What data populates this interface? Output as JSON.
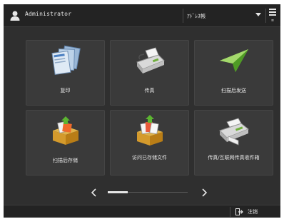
{
  "header": {
    "user_name": "Administrator",
    "user_icon": "user-icon",
    "dropdown_value": "ｱﾄﾞﾚｽ帳",
    "menu_icon": "menu-icon",
    "menu_sub": "≡"
  },
  "tiles": [
    {
      "label": "复印",
      "icon": "copy-icon"
    },
    {
      "label": "传真",
      "icon": "fax-icon"
    },
    {
      "label": "扫描后发送",
      "icon": "scan-send-icon"
    },
    {
      "label": "扫描后存储",
      "icon": "scan-store-icon"
    },
    {
      "label": "访问已存储文件",
      "icon": "stored-files-icon"
    },
    {
      "label": "传真/互联网传真收件箱",
      "icon": "fax-inbox-icon"
    }
  ],
  "pager": {
    "prev_icon": "chevron-left-icon",
    "next_icon": "chevron-right-icon",
    "page": 1,
    "page_count": 4
  },
  "footer": {
    "logout_label": "注销",
    "logout_icon": "logout-icon"
  },
  "colors": {
    "background": "#2f2f2f",
    "bar": "#232323",
    "tile": "#3a3a3a",
    "text": "#e8e8e8"
  }
}
